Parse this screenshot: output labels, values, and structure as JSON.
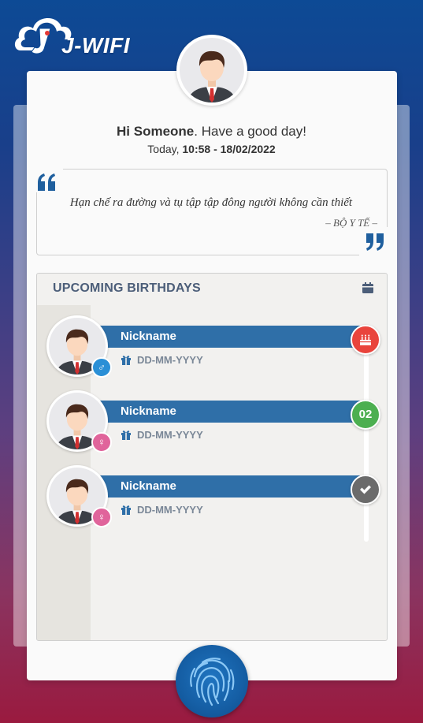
{
  "app": {
    "logo_text": "J-WIFI",
    "logo_icon": "cloud-logo-icon"
  },
  "header": {
    "greeting_hi": "Hi",
    "user_name": "Someone",
    "greeting_rest": ". Have a good day!",
    "today_label": "Today,",
    "time_date": "10:58 - 18/02/2022"
  },
  "quote": {
    "text": "Hạn chế ra đường và tụ tập tập đông người không cần thiết",
    "author": "– BỘ Y TẾ –"
  },
  "birthdays": {
    "title": "UPCOMING BIRTHDAYS",
    "items": [
      {
        "nickname": "Nickname",
        "date": "DD-MM-YYYY",
        "gender": "male",
        "gender_symbol": "♂",
        "status": "cake-icon",
        "status_text": "",
        "status_color": "#e9443c"
      },
      {
        "nickname": "Nickname",
        "date": "DD-MM-YYYY",
        "gender": "female",
        "gender_symbol": "♀",
        "status": "days-left",
        "status_text": "02",
        "status_color": "#4caf50"
      },
      {
        "nickname": "Nickname",
        "date": "DD-MM-YYYY",
        "gender": "female",
        "gender_symbol": "♀",
        "status": "check-icon",
        "status_text": "",
        "status_color": "#6b6b6b"
      }
    ]
  },
  "colors": {
    "accent": "#2f6fa8",
    "title": "#4c5e79",
    "male": "#2a8fd6",
    "female": "#e0649b",
    "quote_marks": "#1f5f9e"
  },
  "footer": {
    "fingerprint_icon": "fingerprint-icon"
  }
}
